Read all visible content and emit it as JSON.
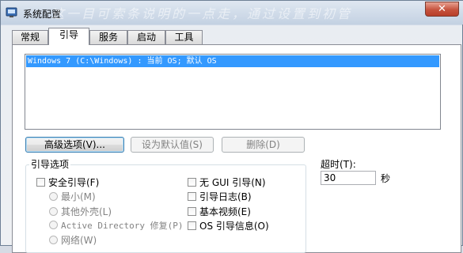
{
  "window": {
    "title": "系统配置",
    "watermark": "这一目可索条说明的一点走，通过设置到初管",
    "close_glyph": "✕"
  },
  "tabs": [
    {
      "label": "常规",
      "active": false
    },
    {
      "label": "引导",
      "active": true
    },
    {
      "label": "服务",
      "active": false
    },
    {
      "label": "启动",
      "active": false
    },
    {
      "label": "工具",
      "active": false
    }
  ],
  "os_list": {
    "items": [
      "Windows 7 (C:\\Windows) : 当前 OS; 默认 OS"
    ],
    "selected_index": 0
  },
  "buttons": {
    "advanced": "高级选项(V)...",
    "set_default": "设为默认值(S)",
    "delete": "删除(D)"
  },
  "boot_options": {
    "title": "引导选项",
    "safe_boot": "安全引导(F)",
    "minimal": "最小(M)",
    "alternate_shell": "其他外壳(L)",
    "ad_repair": "Active Directory 修复(P)",
    "network": "网络(W)",
    "no_gui": "无 GUI 引导(N)",
    "boot_log": "引导日志(B)",
    "base_video": "基本视频(E)",
    "os_boot_info": "OS 引导信息(O)"
  },
  "timeout": {
    "label": "超时(T):",
    "value": "30",
    "unit": "秒"
  }
}
